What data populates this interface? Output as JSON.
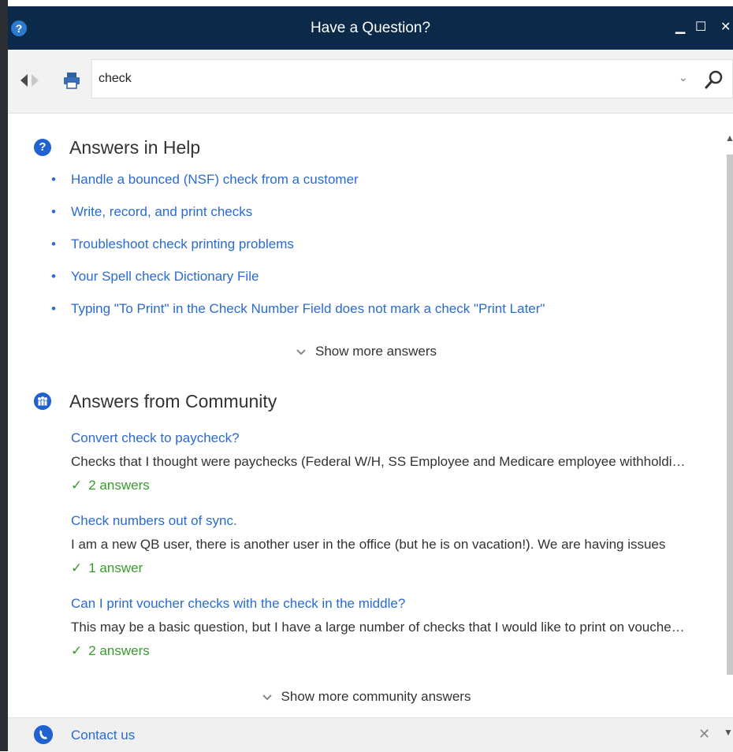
{
  "titlebar": {
    "title": "Have a Question?",
    "minimize": "▁",
    "maximize": "☐",
    "close": "✕",
    "help_glyph": "?"
  },
  "toolbar": {
    "back_icon": "back-arrow-icon",
    "forward_icon": "forward-arrow-icon",
    "print_icon": "printer-icon",
    "search": {
      "value": "check",
      "dropdown_glyph": "⌄",
      "search_icon": "search-icon"
    }
  },
  "help": {
    "heading": "Answers in Help",
    "icon_glyph": "?",
    "bullet": "•",
    "items": [
      "Handle a bounced (NSF) check from a customer",
      "Write, record, and print checks",
      "Troubleshoot check printing problems",
      "Your Spell check Dictionary File",
      "Typing \"To Print\" in the Check Number Field does not mark a check \"Print Later\""
    ],
    "show_more": "Show more answers"
  },
  "community": {
    "heading": "Answers from Community",
    "check_glyph": "✓",
    "posts": [
      {
        "title": "Convert check to paycheck?",
        "snippet": "Checks that I thought were paychecks (Federal W/H, SS Employee and Medicare employee withholding) were entered",
        "answers": "2 answers"
      },
      {
        "title": "Check numbers out of sync.",
        "snippet": "I am a new QB user, there is another user in the office (but he is on vacation!).  We are having issues",
        "answers": "1 answer"
      },
      {
        "title": "Can I print voucher checks with the check in the middle?",
        "snippet": "This may be a basic question, but I have a large number of checks that I would like to print on voucher stock",
        "answers": "2 answers"
      }
    ],
    "show_more": "Show more community answers"
  },
  "footer": {
    "contact_label": "Contact us",
    "close_glyph": "✕"
  },
  "colors": {
    "link": "#2a6bd1",
    "accent": "#1f62d0",
    "titlebar": "#0b2a4a",
    "answers_green": "#3a9a2e"
  }
}
